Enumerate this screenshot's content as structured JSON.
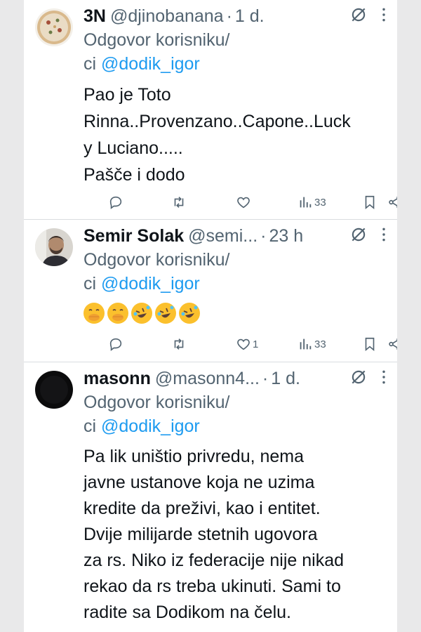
{
  "tweets": [
    {
      "name": "3N",
      "handle": "@djinobanana",
      "time": "1 d.",
      "reply_prefix": "Odgovor korisniku/",
      "reply_prefix2": "ci",
      "reply_to": "@dodik_igor",
      "lines": [
        "Pao je Toto",
        "Rinna..Provenzano..Capone..Luck",
        "y Luciano.....",
        "Pašče i dodo"
      ],
      "likes": "",
      "views": "33"
    },
    {
      "name": "Semir Solak",
      "handle": "@semi...",
      "time": "23 h",
      "reply_prefix": "Odgovor korisniku/",
      "reply_prefix2": "ci",
      "reply_to": "@dodik_igor",
      "emojis": [
        "face-with-hand-over-mouth",
        "face-with-hand-over-mouth",
        "rolling-on-floor-laughing",
        "rolling-on-floor-laughing",
        "rolling-on-floor-laughing"
      ],
      "likes": "1",
      "views": "33"
    },
    {
      "name": "masonn",
      "handle": "@masonn4...",
      "time": "1 d.",
      "reply_prefix": "Odgovor korisniku/",
      "reply_prefix2": "ci",
      "reply_to": "@dodik_igor",
      "lines": [
        "Pa lik uništio  privredu,  nema",
        "javne ustanove koja ne uzima",
        "kredite da preživi,  kao i entitet.",
        "Dvije milijarde  stetnih  ugovora",
        "za rs. Niko iz federacije  nije nikad",
        "rekao da rs treba ukinuti. Sami to",
        "radite sa Dodikom na čelu."
      ]
    }
  ],
  "colors": {
    "accent": "#1d9bf0",
    "secondary": "#536471",
    "text": "#0f1419",
    "emoji": "#fbc02d"
  }
}
